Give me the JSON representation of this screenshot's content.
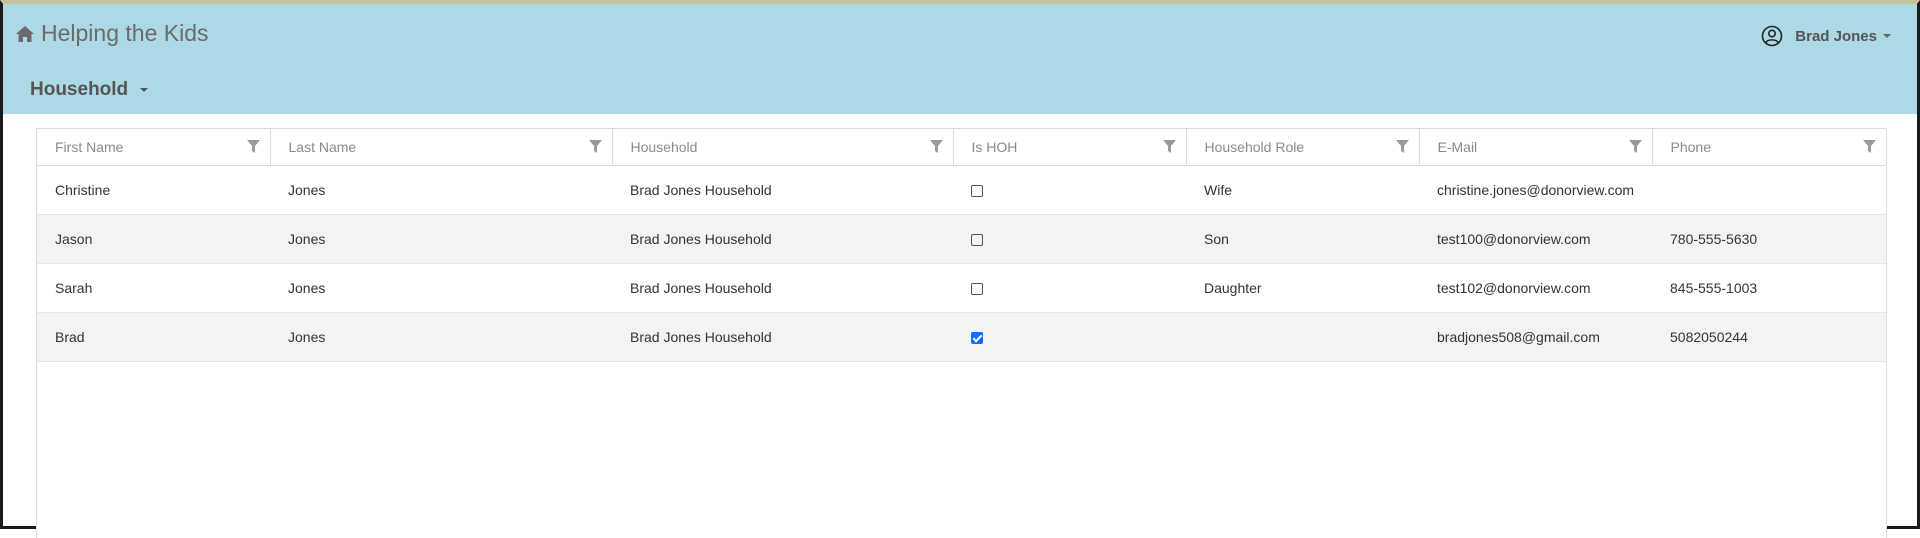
{
  "app": {
    "title": "Helping the Kids",
    "home_icon": "home-icon"
  },
  "user": {
    "name": "Brad Jones",
    "icon": "user-circle-icon"
  },
  "section": {
    "label": "Household"
  },
  "grid": {
    "columns": [
      "First Name",
      "Last Name",
      "Household",
      "Is HOH",
      "Household Role",
      "E-Mail",
      "Phone"
    ],
    "rows": [
      {
        "first": "Christine",
        "last": "Jones",
        "household": "Brad Jones Household",
        "is_hoh": false,
        "role": "Wife",
        "email": "christine.jones@donorview.com",
        "phone": ""
      },
      {
        "first": "Jason",
        "last": "Jones",
        "household": "Brad Jones Household",
        "is_hoh": false,
        "role": "Son",
        "email": "test100@donorview.com",
        "phone": "780-555-5630"
      },
      {
        "first": "Sarah",
        "last": "Jones",
        "household": "Brad Jones Household",
        "is_hoh": false,
        "role": "Daughter",
        "email": "test102@donorview.com",
        "phone": "845-555-1003"
      },
      {
        "first": "Brad",
        "last": "Jones",
        "household": "Brad Jones Household",
        "is_hoh": true,
        "role": "",
        "email": "bradjones508@gmail.com",
        "phone": "5082050244"
      }
    ]
  },
  "colors": {
    "header_bg": "#add8e6",
    "checkbox_checked": "#0d6efd"
  }
}
